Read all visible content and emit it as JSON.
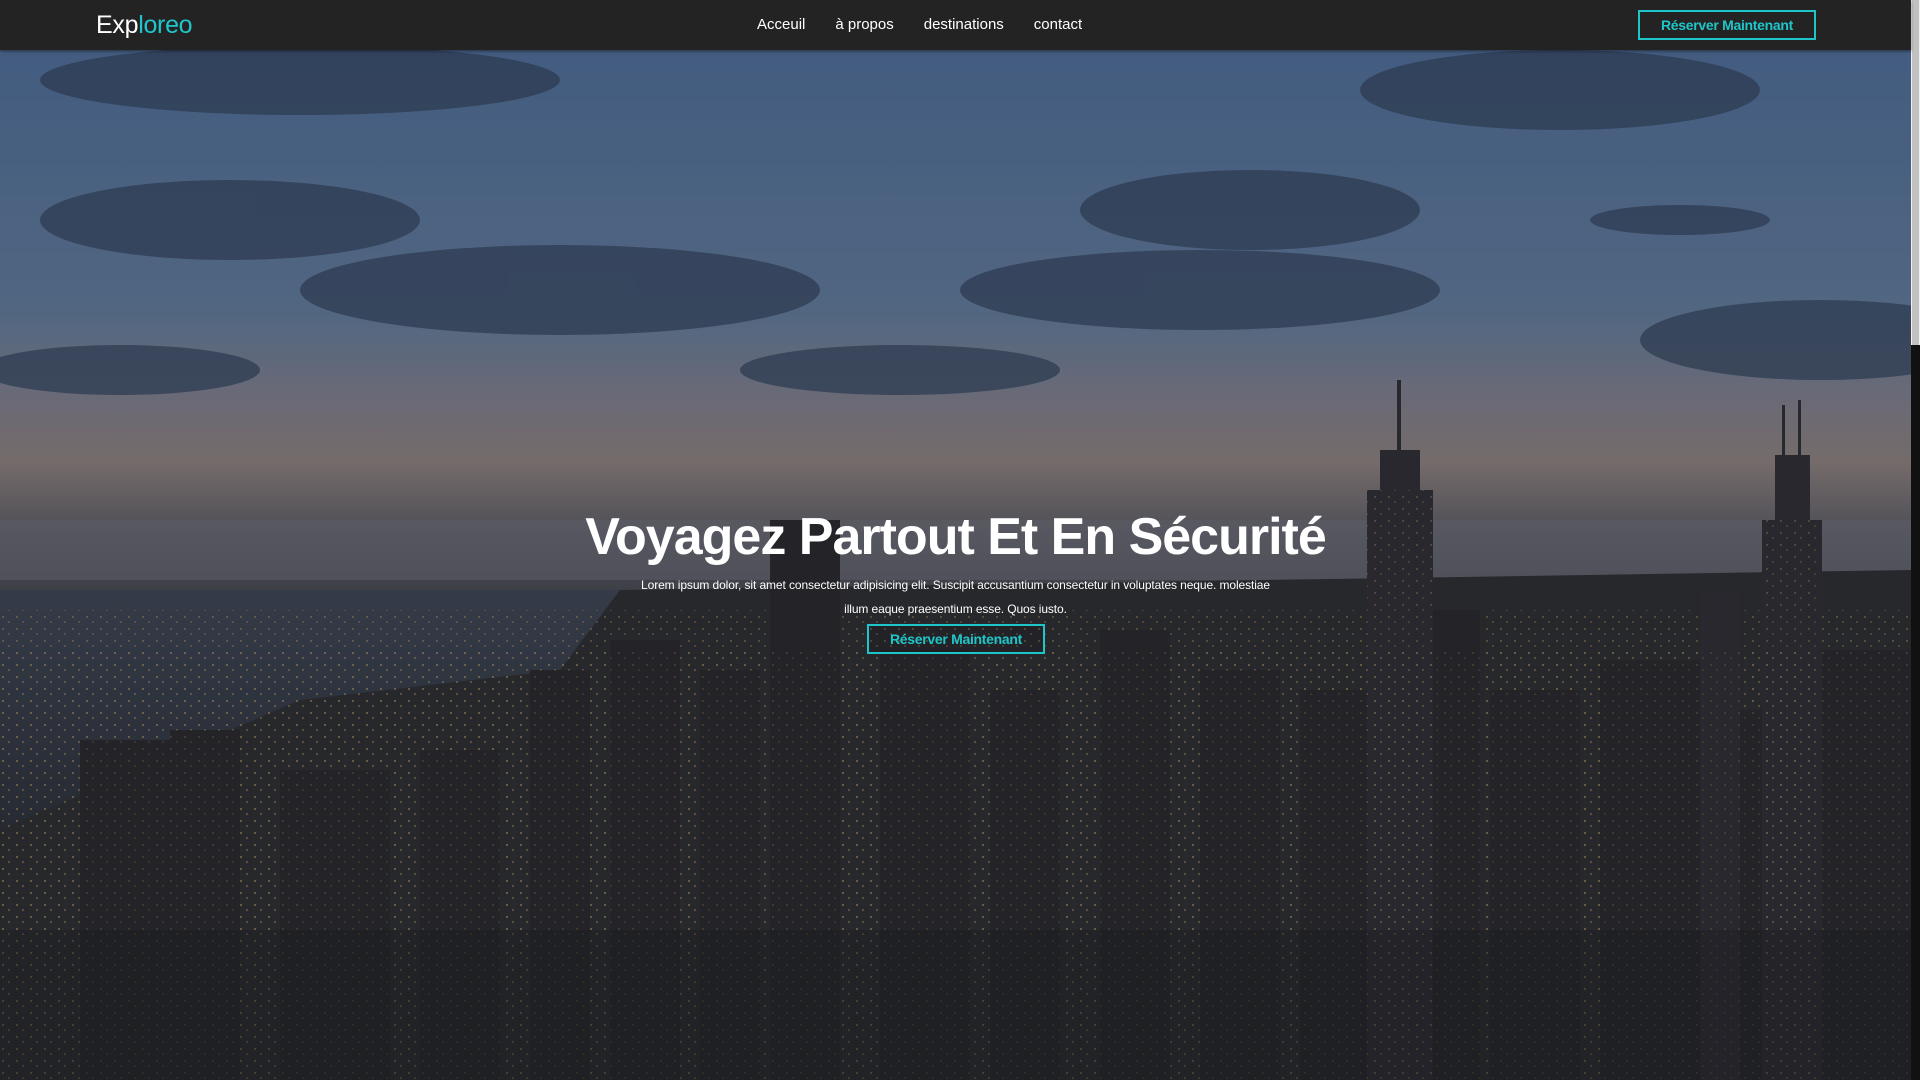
{
  "brand": {
    "part1": "Exp",
    "part2": "loreo"
  },
  "nav": {
    "items": [
      {
        "label": "Acceuil"
      },
      {
        "label": "à propos"
      },
      {
        "label": "destinations"
      },
      {
        "label": "contact"
      }
    ],
    "cta_label": "Réserver Maintenant"
  },
  "hero": {
    "title": "Voyagez Partout Et En Sécurité",
    "description": "Lorem ipsum dolor, sit amet consectetur adipisicing elit. Suscipit accusantium consectetur in voluptates neque. molestiae illum eaque praesentium esse. Quos iusto.",
    "cta_label": "Réserver Maintenant"
  },
  "colors": {
    "accent": "#1fc6c9",
    "header_bg": "#232323",
    "text": "#ffffff"
  },
  "icons": {
    "background": "city-skyline-night-image"
  }
}
